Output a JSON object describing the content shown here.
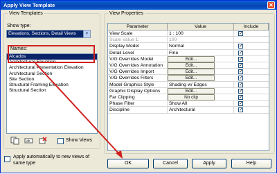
{
  "window": {
    "title": "Apply View Template",
    "close_glyph": "✕"
  },
  "view_templates": {
    "legend": "View Templates",
    "show_type_label": "Show type:",
    "show_type_value": "Elevations, Sections, Detail Views",
    "names_label": "Names:",
    "names": [
      "Alcados",
      "Architectural Elevation",
      "Architectural Presentation Elevation",
      "Architectural Section",
      "Site Section",
      "Structural Framing Elevation",
      "Structural Section"
    ],
    "selected_index": 0,
    "show_views_label": "Show Views",
    "show_views_checked": false,
    "tools": [
      "duplicate-icon",
      "rename-icon",
      "delete-icon"
    ]
  },
  "apply_auto": {
    "label_line1": "Apply automatically to new views of",
    "label_line2": "same type",
    "checked": false
  },
  "view_properties": {
    "legend": "View Properties",
    "headers": [
      "Parameter",
      "Value",
      "Include"
    ],
    "rows": [
      {
        "param": "View Scale",
        "value": "1 : 100",
        "kind": "text",
        "include": true,
        "disabled": false
      },
      {
        "param": "Scale Value  1:",
        "value": "100",
        "kind": "text",
        "include": null,
        "disabled": true
      },
      {
        "param": "Display Model",
        "value": "Normal",
        "kind": "text",
        "include": true,
        "disabled": false
      },
      {
        "param": "Detail Level",
        "value": "Fine",
        "kind": "text",
        "include": true,
        "disabled": false
      },
      {
        "param": "V/G Overrides Model",
        "value": "Edit...",
        "kind": "button",
        "include": true,
        "disabled": false
      },
      {
        "param": "V/G Overrides Annotation",
        "value": "Edit...",
        "kind": "button",
        "include": true,
        "disabled": false
      },
      {
        "param": "V/G Overrides Import",
        "value": "Edit...",
        "kind": "button",
        "include": true,
        "disabled": false
      },
      {
        "param": "V/G Overrides Filters",
        "value": "Edit...",
        "kind": "button",
        "include": true,
        "disabled": false
      },
      {
        "param": "Model Graphics Style",
        "value": "Shading w/ Edges",
        "kind": "text",
        "include": true,
        "disabled": false
      },
      {
        "param": "Graphic Display Options",
        "value": "Edit...",
        "kind": "button",
        "include": true,
        "disabled": false
      },
      {
        "param": "Far Clipping",
        "value": "No clip",
        "kind": "button",
        "include": true,
        "disabled": false
      },
      {
        "param": "Phase Filter",
        "value": "Show All",
        "kind": "text",
        "include": true,
        "disabled": false
      },
      {
        "param": "Discipline",
        "value": "Architectural",
        "kind": "text",
        "include": true,
        "disabled": false
      }
    ]
  },
  "buttons": {
    "ok": "OK",
    "cancel": "Cancel",
    "apply": "Apply",
    "help": "Help"
  },
  "colors": {
    "highlight": "#0a246a",
    "annotation": "#d02020",
    "titlebar": "#0842b0"
  }
}
